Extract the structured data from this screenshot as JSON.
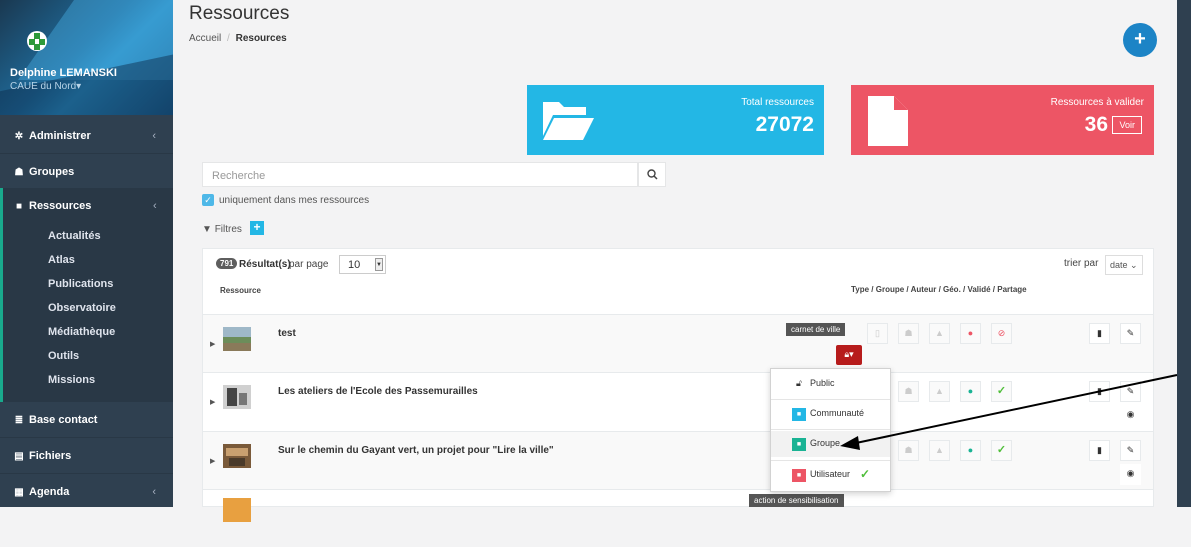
{
  "sidebar": {
    "user_name": "Delphine LEMANSKI",
    "org": "CAUE du Nord",
    "items": [
      {
        "label": "Administrer",
        "icon": "cog-icon"
      },
      {
        "label": "Groupes",
        "icon": "users-icon"
      },
      {
        "label": "Ressources",
        "icon": "folder-icon"
      },
      {
        "label": "Base contact",
        "icon": "database-icon"
      },
      {
        "label": "Fichiers",
        "icon": "file-icon"
      },
      {
        "label": "Agenda",
        "icon": "calendar-icon"
      }
    ],
    "sub_items": [
      "Actualités",
      "Atlas",
      "Publications",
      "Observatoire",
      "Médiathèque",
      "Outils",
      "Missions"
    ]
  },
  "header": {
    "title": "Ressources",
    "breadcrumb_home": "Accueil",
    "breadcrumb_sep": "/",
    "breadcrumb_current": "Resources"
  },
  "stats": {
    "total_label": "Total ressources",
    "total_value": "27072",
    "pending_label": "Ressources à valider",
    "pending_value": "36",
    "voir_label": "Voir"
  },
  "search": {
    "placeholder": "Recherche",
    "checkbox_label": "uniquement dans mes ressources",
    "filters_label": "Filtres"
  },
  "results": {
    "count": "791",
    "count_label": "Résultat(s)",
    "per_page_label": "par page",
    "per_page_value": "10",
    "sort_label": "trier par",
    "sort_value": "date",
    "col_resource": "Ressource",
    "col_type": "Type / Groupe / Auteur / Géo. / Validé / Partage"
  },
  "rows": [
    {
      "title": "test",
      "tag": "carnet de ville"
    },
    {
      "title": "Les ateliers de l'Ecole des Passemurailles",
      "tag": ""
    },
    {
      "title": "Sur le chemin du Gayant vert, un projet pour \"Lire la ville\"",
      "tag": ""
    },
    {
      "title": "",
      "tag": "action de sensibilisation"
    }
  ],
  "share_dropdown": {
    "items": [
      "Public",
      "Communauté",
      "Groupe",
      "Utilisateur"
    ],
    "selected": "Utilisateur"
  },
  "colors": {
    "sidebar": "#2f4050",
    "accent_blue": "#23b7e5",
    "accent_red": "#ed5565",
    "accent_green": "#1ab394"
  }
}
